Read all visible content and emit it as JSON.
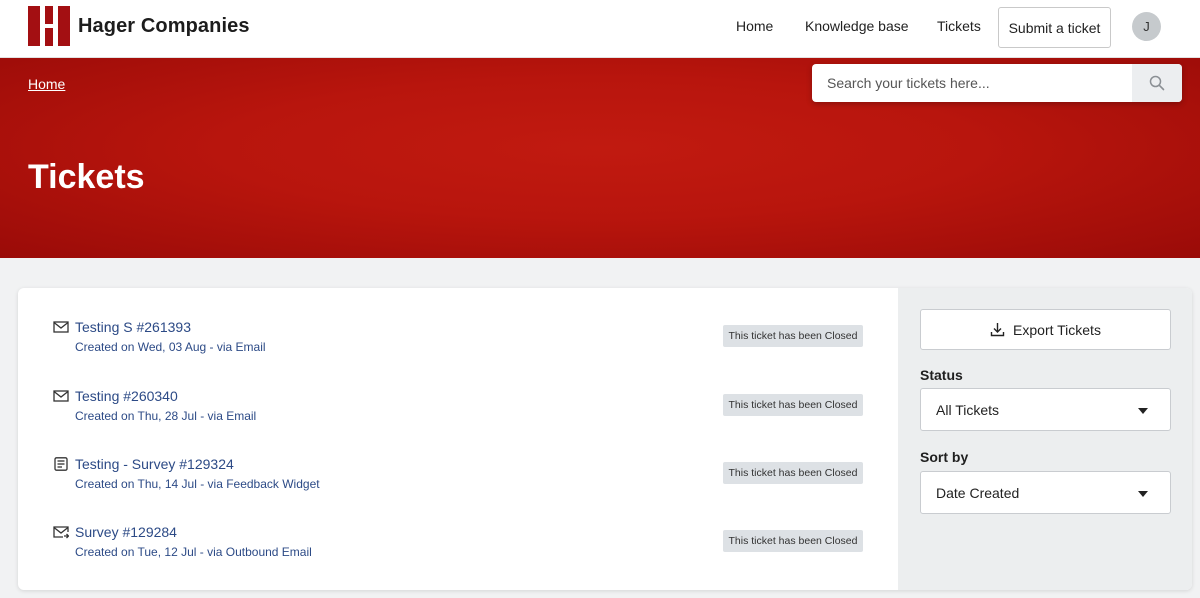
{
  "header": {
    "brand": "Hager Companies",
    "nav": [
      "Home",
      "Knowledge base",
      "Tickets"
    ],
    "submit_label": "Submit a ticket",
    "avatar_initial": "J"
  },
  "hero": {
    "breadcrumb": "Home",
    "title": "Tickets",
    "search_placeholder": "Search your tickets here..."
  },
  "tickets": [
    {
      "title": "Testing S #261393",
      "subtitle": "Created on Wed, 03 Aug - via Email",
      "status": "This ticket has been Closed",
      "icon": "mail-icon"
    },
    {
      "title": "Testing #260340",
      "subtitle": "Created on Thu, 28 Jul - via Email",
      "status": "This ticket has been Closed",
      "icon": "mail-icon"
    },
    {
      "title": "Testing - Survey #129324",
      "subtitle": "Created on Thu, 14 Jul - via Feedback Widget",
      "status": "This ticket has been Closed",
      "icon": "feedback-widget-icon"
    },
    {
      "title": "Survey #129284",
      "subtitle": "Created on Tue, 12 Jul - via Outbound Email",
      "status": "This ticket has been Closed",
      "icon": "outbound-mail-icon"
    }
  ],
  "sidebar": {
    "export_label": "Export Tickets",
    "status_label": "Status",
    "status_value": "All Tickets",
    "sort_label": "Sort by",
    "sort_value": "Date Created"
  },
  "colors": {
    "brand_red": "#a30f12",
    "hero_red": "#b8150d",
    "link_blue": "#2c4a86"
  }
}
